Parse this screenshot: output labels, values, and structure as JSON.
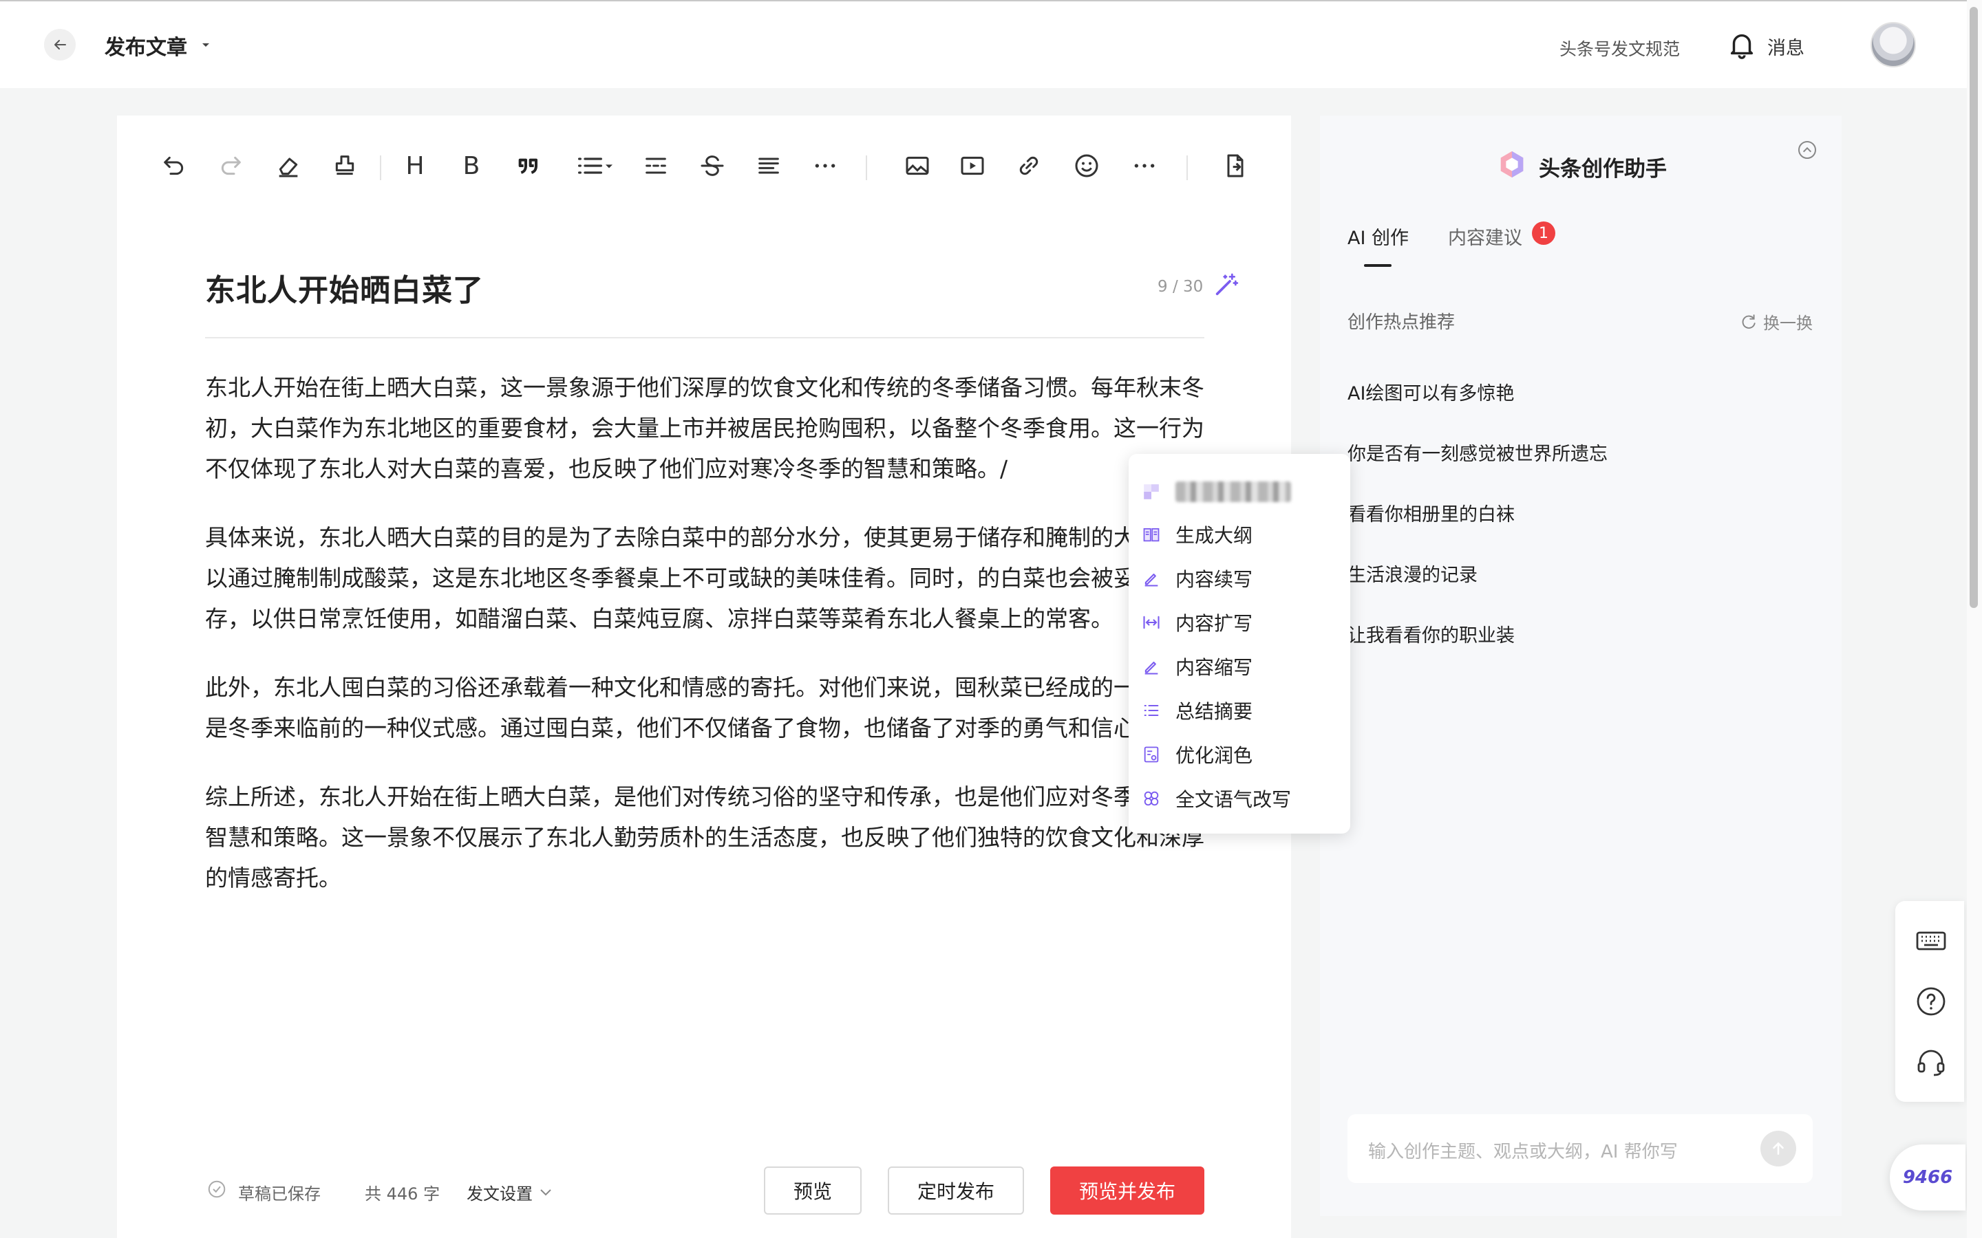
{
  "header": {
    "title": "发布文章",
    "rules_link": "头条号发文规范",
    "messages_label": "消息"
  },
  "toolbar": {
    "heading": "H",
    "bold": "B"
  },
  "article": {
    "title": "东北人开始晒白菜了",
    "title_count": "9 / 30",
    "paragraphs": [
      "东北人开始在街上晒大白菜，这一景象源于他们深厚的饮食文化和传统的冬季储备习惯。每年秋末冬初，大白菜作为东北地区的重要食材，会大量上市并被居民抢购囤积，以备整个冬季食用。这一行为不仅体现了东北人对大白菜的喜爱，也反映了他们应对寒冷冬季的智慧和策略。/",
      "具体来说，东北人晒大白菜的目的是为了去除白菜中的部分水分，使其更易于储存和腌制的大白菜可以通过腌制制成酸菜，这是东北地区冬季餐桌上不可或缺的美味佳肴。同时，的白菜也会被妥善储存，以供日常烹饪使用，如醋溜白菜、白菜炖豆腐、凉拌白菜等菜肴东北人餐桌上的常客。",
      "此外，东北人囤白菜的习俗还承载着一种文化和情感的寄托。对他们来说，囤秋菜已经成的一部分，是冬季来临前的一种仪式感。通过囤白菜，他们不仅储备了食物，也储备了对季的勇气和信心。",
      "综上所述，东北人开始在街上晒大白菜，是他们对传统习俗的坚守和传承，也是他们应对冬季生活的智慧和策略。这一景象不仅展示了东北人勤劳质朴的生活态度，也反映了他们独特的饮食文化和深厚的情感寄托。"
    ]
  },
  "popup": {
    "items": [
      {
        "label": "生成大纲",
        "icon": "book-icon"
      },
      {
        "label": "内容续写",
        "icon": "pen-icon"
      },
      {
        "label": "内容扩写",
        "icon": "expand-icon"
      },
      {
        "label": "内容缩写",
        "icon": "pen-icon"
      },
      {
        "label": "总结摘要",
        "icon": "list-icon"
      },
      {
        "label": "优化润色",
        "icon": "polish-icon"
      },
      {
        "label": "全文语气改写",
        "icon": "clover-icon"
      }
    ]
  },
  "footer": {
    "saved": "草稿已保存",
    "word_count": "共 446 字",
    "settings": "发文设置",
    "preview": "预览",
    "schedule": "定时发布",
    "publish": "预览并发布"
  },
  "assistant": {
    "title": "头条创作助手",
    "tab_ai": "AI 创作",
    "tab_suggest": "内容建议",
    "suggest_badge": "1",
    "hot_header": "创作热点推荐",
    "refresh": "换一换",
    "topics": [
      "AI绘图可以有多惊艳",
      "你是否有一刻感觉被世界所遗忘",
      "看看你相册里的白袜",
      "生活浪漫的记录",
      "让我看看你的职业装"
    ],
    "input_placeholder": "输入创作主题、观点或大纲，AI 帮你写"
  },
  "fab": {
    "label": "9466"
  },
  "colors": {
    "accent": "#f04142",
    "ai_purple": "#7b5cf0"
  }
}
